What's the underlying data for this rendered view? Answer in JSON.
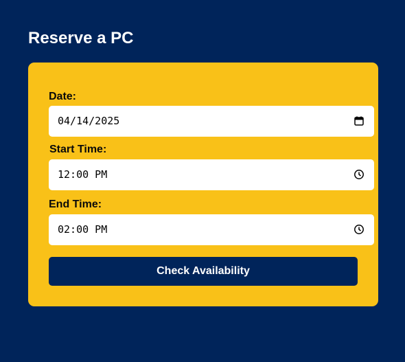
{
  "page": {
    "title": "Reserve a PC"
  },
  "form": {
    "date": {
      "label": "Date:",
      "value": "04/14/2025",
      "icon": "calendar-icon"
    },
    "start_time": {
      "label": "Start Time:",
      "value": "12:00 PM",
      "icon": "clock-icon"
    },
    "end_time": {
      "label": "End Time:",
      "value": "02:00 PM",
      "icon": "clock-icon"
    },
    "submit_label": "Check Availability"
  },
  "colors": {
    "background": "#00245a",
    "card": "#f9c118",
    "button": "#00245a",
    "field": "#ffffff"
  }
}
